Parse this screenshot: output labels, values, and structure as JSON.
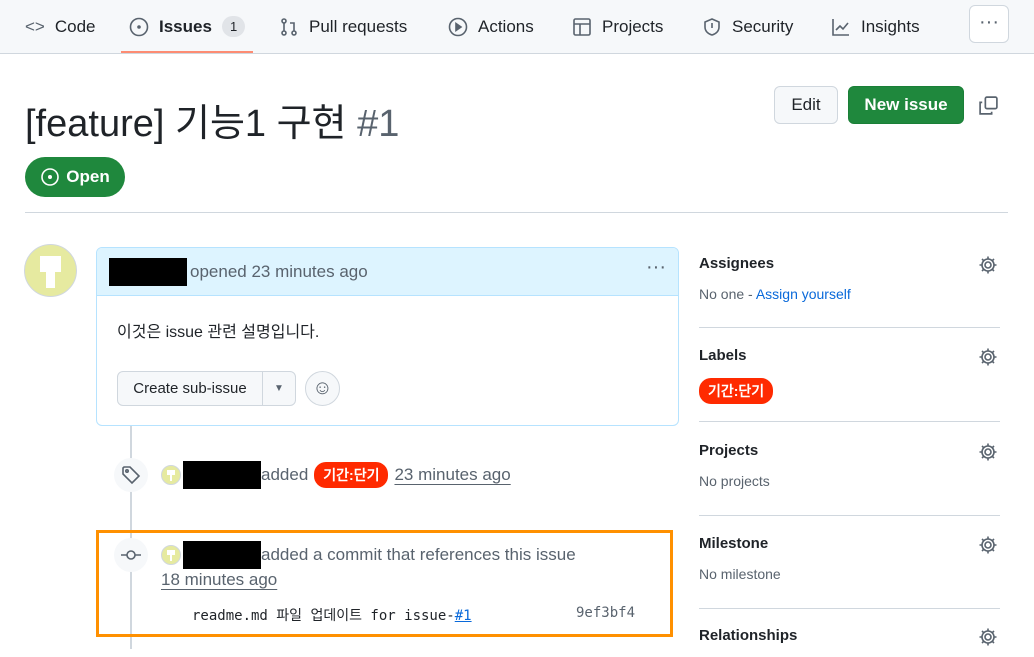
{
  "nav": {
    "tabs": [
      {
        "label": "Code",
        "icon": "code-icon"
      },
      {
        "label": "Issues",
        "icon": "issue-opened-icon",
        "count": "1"
      },
      {
        "label": "Pull requests",
        "icon": "git-pull-request-icon"
      },
      {
        "label": "Actions",
        "icon": "play-icon"
      },
      {
        "label": "Projects",
        "icon": "table-icon"
      },
      {
        "label": "Security",
        "icon": "shield-icon"
      },
      {
        "label": "Insights",
        "icon": "graph-icon"
      }
    ],
    "more": "···"
  },
  "issue": {
    "title": "[feature] 기능1 구현",
    "number": "#1",
    "state": "Open",
    "edit_label": "Edit",
    "new_label": "New issue"
  },
  "comment": {
    "action": "opened 23 minutes ago",
    "body": "이것은 issue 관련 설명입니다.",
    "sub_issue_label": "Create sub-issue"
  },
  "events": [
    {
      "action": "added",
      "label": "기간:단기",
      "time": "23 minutes ago"
    },
    {
      "action": "added a commit that references this issue",
      "time": "18 minutes ago",
      "commit_msg": "readme.md 파일 업데이트 for issue-",
      "commit_ref": "#1",
      "sha": "9ef3bf4"
    }
  ],
  "sidebar": {
    "assignees": {
      "title": "Assignees",
      "none": "No one - ",
      "assign": "Assign yourself"
    },
    "labels": {
      "title": "Labels",
      "label": "기간:단기"
    },
    "projects": {
      "title": "Projects",
      "value": "No projects"
    },
    "milestone": {
      "title": "Milestone",
      "value": "No milestone"
    },
    "relationships": {
      "title": "Relationships"
    }
  },
  "colors": {
    "label": "#ff2a00",
    "green": "#1f883d",
    "highlight": "#ff9000"
  }
}
